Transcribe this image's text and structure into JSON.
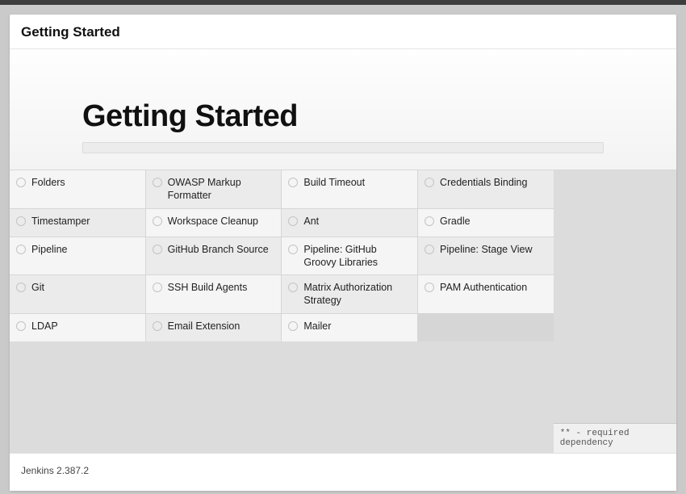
{
  "header": {
    "title": "Getting Started"
  },
  "hero": {
    "title": "Getting Started"
  },
  "plugins": [
    {
      "name": "Folders"
    },
    {
      "name": "OWASP Markup Formatter"
    },
    {
      "name": "Build Timeout"
    },
    {
      "name": "Credentials Binding"
    },
    {
      "name": "Timestamper"
    },
    {
      "name": "Workspace Cleanup"
    },
    {
      "name": "Ant"
    },
    {
      "name": "Gradle"
    },
    {
      "name": "Pipeline"
    },
    {
      "name": "GitHub Branch Source"
    },
    {
      "name": "Pipeline: GitHub Groovy Libraries"
    },
    {
      "name": "Pipeline: Stage View"
    },
    {
      "name": "Git"
    },
    {
      "name": "SSH Build Agents"
    },
    {
      "name": "Matrix Authorization Strategy"
    },
    {
      "name": "PAM Authentication"
    },
    {
      "name": "LDAP"
    },
    {
      "name": "Email Extension"
    },
    {
      "name": "Mailer"
    }
  ],
  "legend": {
    "text": "** - required dependency"
  },
  "footer": {
    "version": "Jenkins 2.387.2"
  }
}
